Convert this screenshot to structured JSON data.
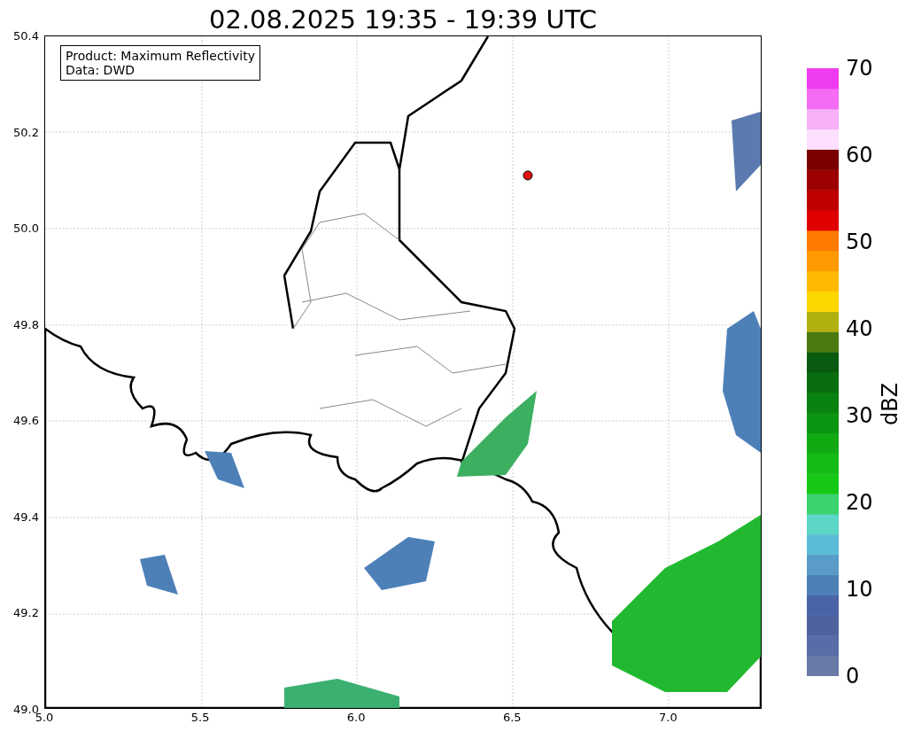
{
  "title": "02.08.2025 19:35 - 19:39 UTC",
  "legend": [
    "Product: Maximum Reflectivity",
    "Data: DWD"
  ],
  "y_ticks": [
    "50.4",
    "50.2",
    "50.0",
    "49.8",
    "49.6",
    "49.4",
    "49.2",
    "49.0"
  ],
  "x_ticks": [
    "5.0",
    "5.5",
    "6.0",
    "6.5",
    "7.0"
  ],
  "colorbar": {
    "label": "dBZ",
    "ticks": [
      "70",
      "60",
      "50",
      "40",
      "30",
      "20",
      "10",
      "0"
    ]
  }
}
